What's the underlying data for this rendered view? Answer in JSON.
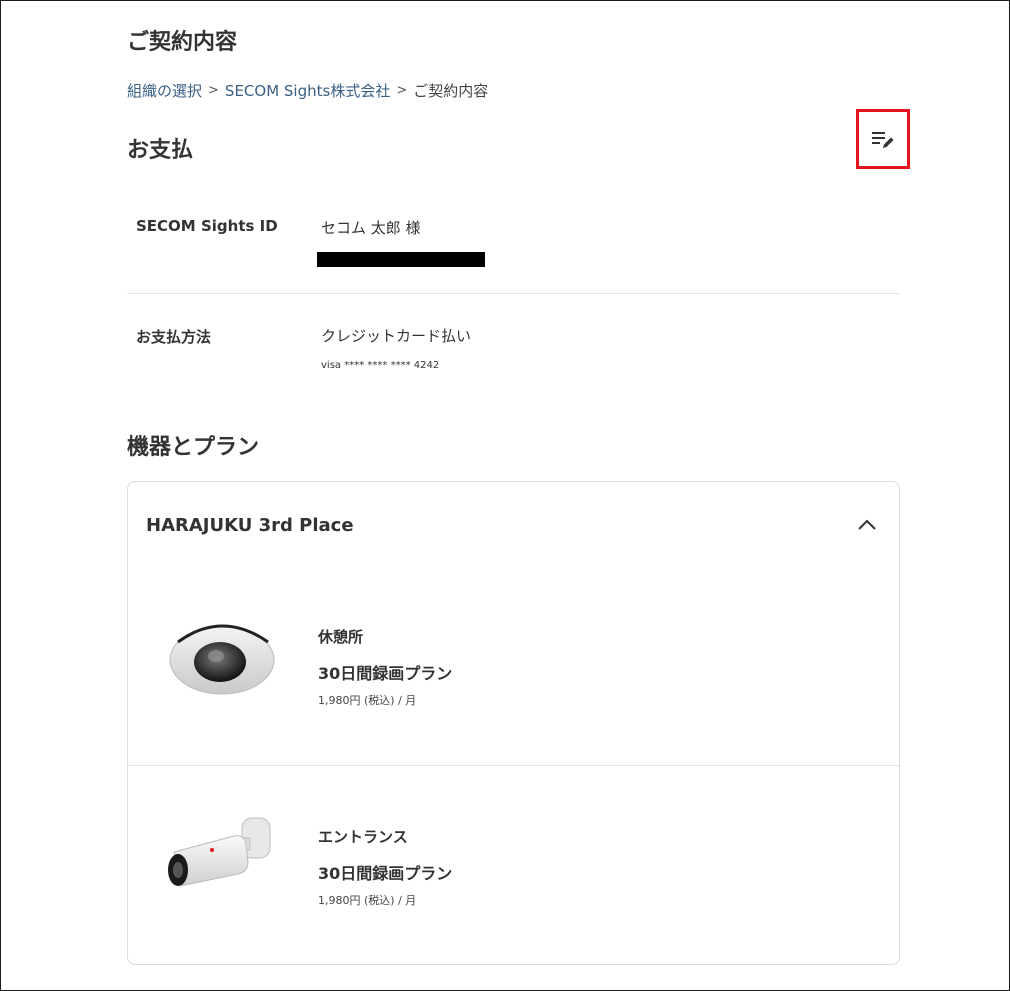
{
  "page": {
    "title": "ご契約内容"
  },
  "breadcrumb": {
    "items": [
      {
        "label": "組織の選択"
      },
      {
        "label": "SECOM Sights株式会社"
      },
      {
        "label": "ご契約内容"
      }
    ],
    "separator": ">"
  },
  "payment": {
    "section_title": "お支払",
    "edit_icon": "edit-list-icon",
    "rows": [
      {
        "label": "SECOM Sights ID",
        "value": "セコム 太郎 様"
      },
      {
        "label": "お支払方法",
        "value": "クレジットカード払い",
        "sub": "visa **** **** **** 4242"
      }
    ]
  },
  "devices": {
    "section_title": "機器とプラン",
    "location": "HARAJUKU 3rd Place",
    "collapse_icon": "chevron-up-icon",
    "items": [
      {
        "name": "休憩所",
        "plan": "30日間録画プラン",
        "price": "1,980円 (税込) / 月",
        "image": "dome-camera-image"
      },
      {
        "name": "エントランス",
        "plan": "30日間録画プラン",
        "price": "1,980円 (税込) / 月",
        "image": "bullet-camera-image"
      }
    ]
  },
  "colors": {
    "link": "#3a5f85",
    "highlight": "#e3121e",
    "text": "#333333"
  }
}
